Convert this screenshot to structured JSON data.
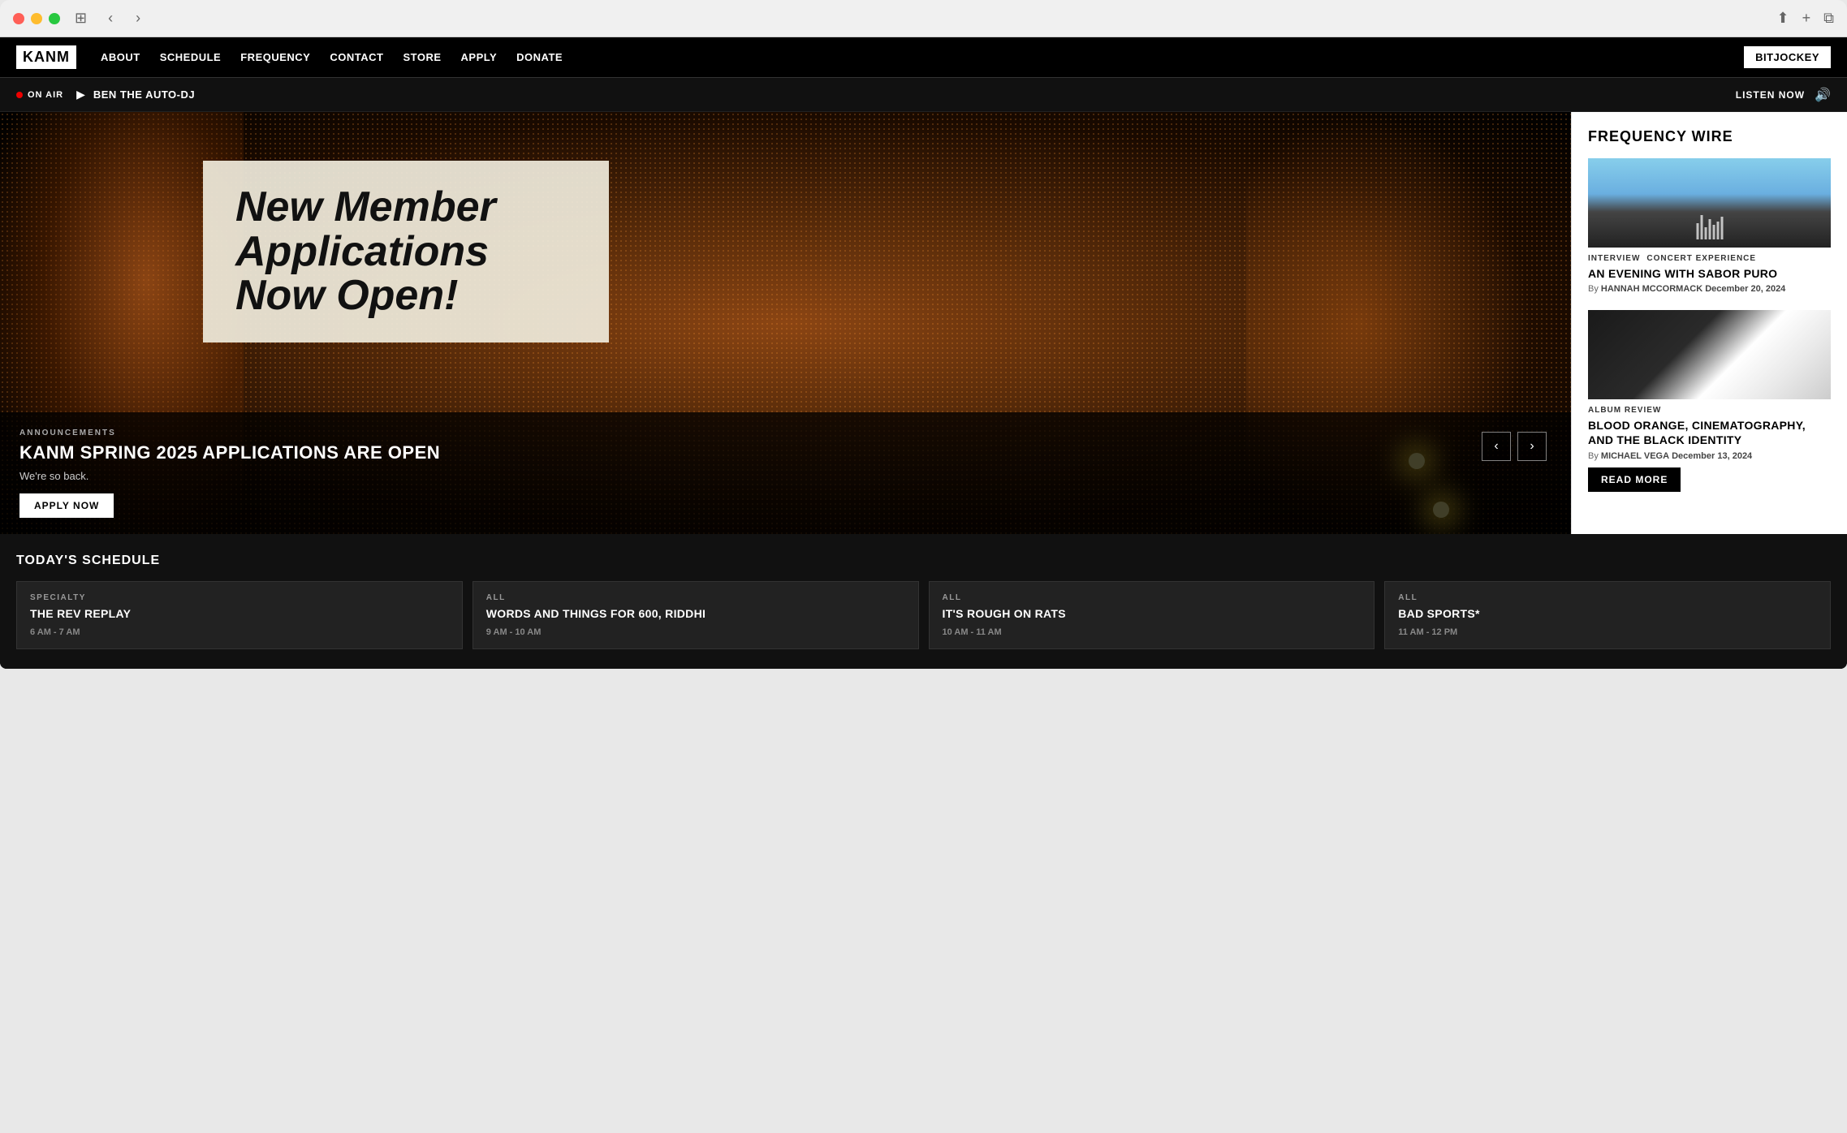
{
  "browser": {
    "back_btn": "‹",
    "forward_btn": "›",
    "sidebar_icon": "⊞",
    "share_icon": "↑",
    "new_tab_icon": "+",
    "tabs_icon": "⧉"
  },
  "site": {
    "logo_text": "KANM",
    "nav": {
      "about": "ABOUT",
      "schedule": "SCHEDULE",
      "frequency": "FREQUENCY",
      "contact": "CONTACT",
      "store": "STORE",
      "apply": "APPLY",
      "donate": "DONATE"
    },
    "header_btn": "BITJOCKEY"
  },
  "on_air": {
    "label": "ON AIR",
    "show": "BEN THE AUTO-DJ",
    "listen_now": "LISTEN NOW"
  },
  "hero": {
    "member_app_heading": "New Member Applications Now Open!",
    "category": "ANNOUNCEMENTS",
    "title": "KANM SPRING 2025 APPLICATIONS ARE OPEN",
    "subtitle": "We're so back.",
    "apply_btn": "APPLY NOW",
    "arrow_left": "‹",
    "arrow_right": "›"
  },
  "frequency_wire": {
    "title": "FREQUENCY WIRE",
    "articles": [
      {
        "tags": [
          "INTERVIEW",
          "CONCERT EXPERIENCE"
        ],
        "title": "AN EVENING WITH SABOR PURO",
        "byline": "HANNAH MCCORMACK",
        "date": "December 20, 2024"
      },
      {
        "tags": [
          "ALBUM REVIEW"
        ],
        "title": "BLOOD ORANGE, CINEMATOGRAPHY, AND THE BLACK IDENTITY",
        "byline": "MICHAEL VEGA",
        "date": "December 13, 2024"
      }
    ],
    "read_more_btn": "READ MORE"
  },
  "schedule": {
    "title": "TODAY'S SCHEDULE",
    "cards": [
      {
        "type": "SPECIALTY",
        "title": "THE REV REPLAY",
        "time": "6 AM - 7 AM"
      },
      {
        "type": "ALL",
        "title": "WORDS AND THINGS FOR 600, RIDDHI",
        "time": "9 AM - 10 AM"
      },
      {
        "type": "ALL",
        "title": "IT'S ROUGH ON RATS",
        "time": "10 AM - 11 AM"
      },
      {
        "type": "ALL",
        "title": "BAD SPORTS*",
        "time": "11 AM - 12 PM"
      }
    ]
  }
}
